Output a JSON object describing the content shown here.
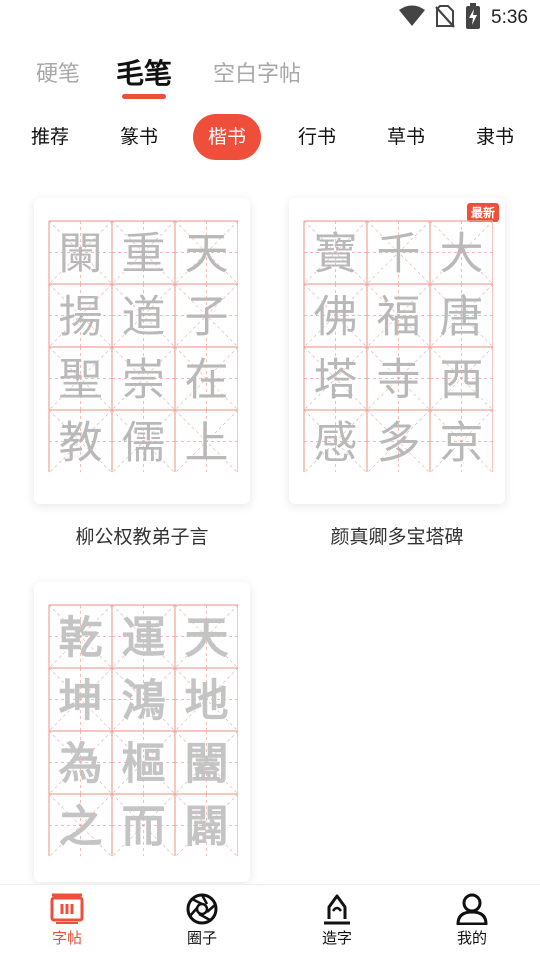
{
  "status_bar": {
    "time": "5:36",
    "icons": [
      "wifi-icon",
      "no-sim-icon",
      "battery-charging-icon"
    ]
  },
  "top_tabs": [
    {
      "label": "硬笔",
      "active": false
    },
    {
      "label": "毛笔",
      "active": true
    },
    {
      "label": "空白字帖",
      "active": false
    }
  ],
  "categories": [
    {
      "label": "推荐",
      "active": false
    },
    {
      "label": "篆书",
      "active": false
    },
    {
      "label": "楷书",
      "active": true
    },
    {
      "label": "行书",
      "active": false
    },
    {
      "label": "草书",
      "active": false
    },
    {
      "label": "隶书",
      "active": false
    }
  ],
  "copybooks": [
    {
      "title": "柳公权教弟子言",
      "characters": [
        "闌",
        "重",
        "天",
        "揚",
        "道",
        "子",
        "聖",
        "崇",
        "在",
        "教",
        "儒",
        "上"
      ],
      "badge": ""
    },
    {
      "title": "颜真卿多宝塔碑",
      "characters": [
        "寶",
        "千",
        "大",
        "佛",
        "福",
        "唐",
        "塔",
        "寺",
        "西",
        "感",
        "多",
        "京"
      ],
      "badge": "最新"
    },
    {
      "title": "",
      "characters": [
        "乾",
        "運",
        "天",
        "坤",
        "鴻",
        "地",
        "為",
        "樞",
        "闔",
        "之",
        "而",
        "闢"
      ],
      "badge": ""
    }
  ],
  "colors": {
    "accent": "#ef4f3a",
    "grid_line": "#f0a49a",
    "inactive_tab": "#a8a8a8"
  },
  "bottom_nav": [
    {
      "label": "字帖",
      "icon": "copybook-icon",
      "active": true
    },
    {
      "label": "圈子",
      "icon": "aperture-icon",
      "active": false
    },
    {
      "label": "造字",
      "icon": "pen-nib-icon",
      "active": false
    },
    {
      "label": "我的",
      "icon": "user-icon",
      "active": false
    }
  ]
}
